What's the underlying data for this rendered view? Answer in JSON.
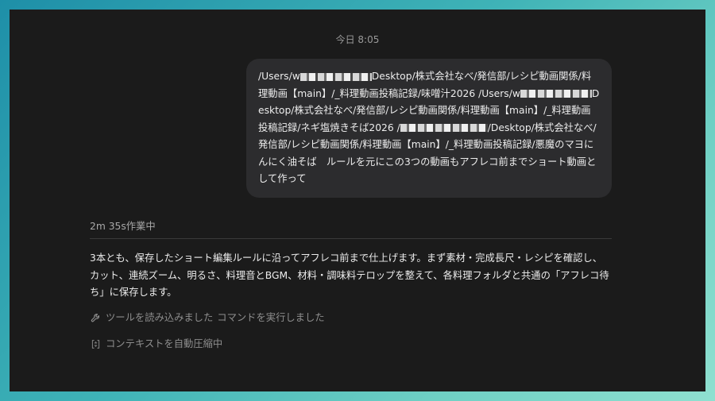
{
  "timestamp": "今日 8:05",
  "user_message": {
    "part1": "/Users/w",
    "part2": "Desktop/株式会社なべ/発信部/レシピ動画関係/料理動画【main】/_料理動画投稿記録/味噌汁2026 /Users/w",
    "part3": "Desktop/株式会社なべ/発信部/レシピ動画関係/料理動画【main】/_料理動画投稿記録/ネギ塩焼きそば2026 /",
    "part4": "/Desktop/株式会社なべ/発信部/レシピ動画関係/料理動画【main】/_料理動画投稿記録/悪魔のマヨにんにく油そば　ルールを元にこの3つの動画もアフレコ前までショート動画として作って"
  },
  "status": {
    "elapsed": "2m 35s作業中"
  },
  "assistant": {
    "text": "3本とも、保存したショート編集ルールに沿ってアフレコ前まで仕上げます。まず素材・完成長尺・レシピを確認し、カット、連続ズーム、明るさ、料理音とBGM、材料・調味料テロップを整えて、各料理フォルダと共通の「アフレコ待ち」に保存します。"
  },
  "activity": {
    "tools_label": "ツールを読み込みました",
    "command_label": "コマンドを実行しました",
    "context_label": "コンテキストを自動圧縮中"
  },
  "icons": {
    "tools": "wrench-icon",
    "context": "compress-icon"
  },
  "colors": {
    "background_window": "#1b1b1b",
    "bubble": "#2c2c2e",
    "text_primary": "#ececec",
    "text_muted": "#8e8e8e"
  }
}
